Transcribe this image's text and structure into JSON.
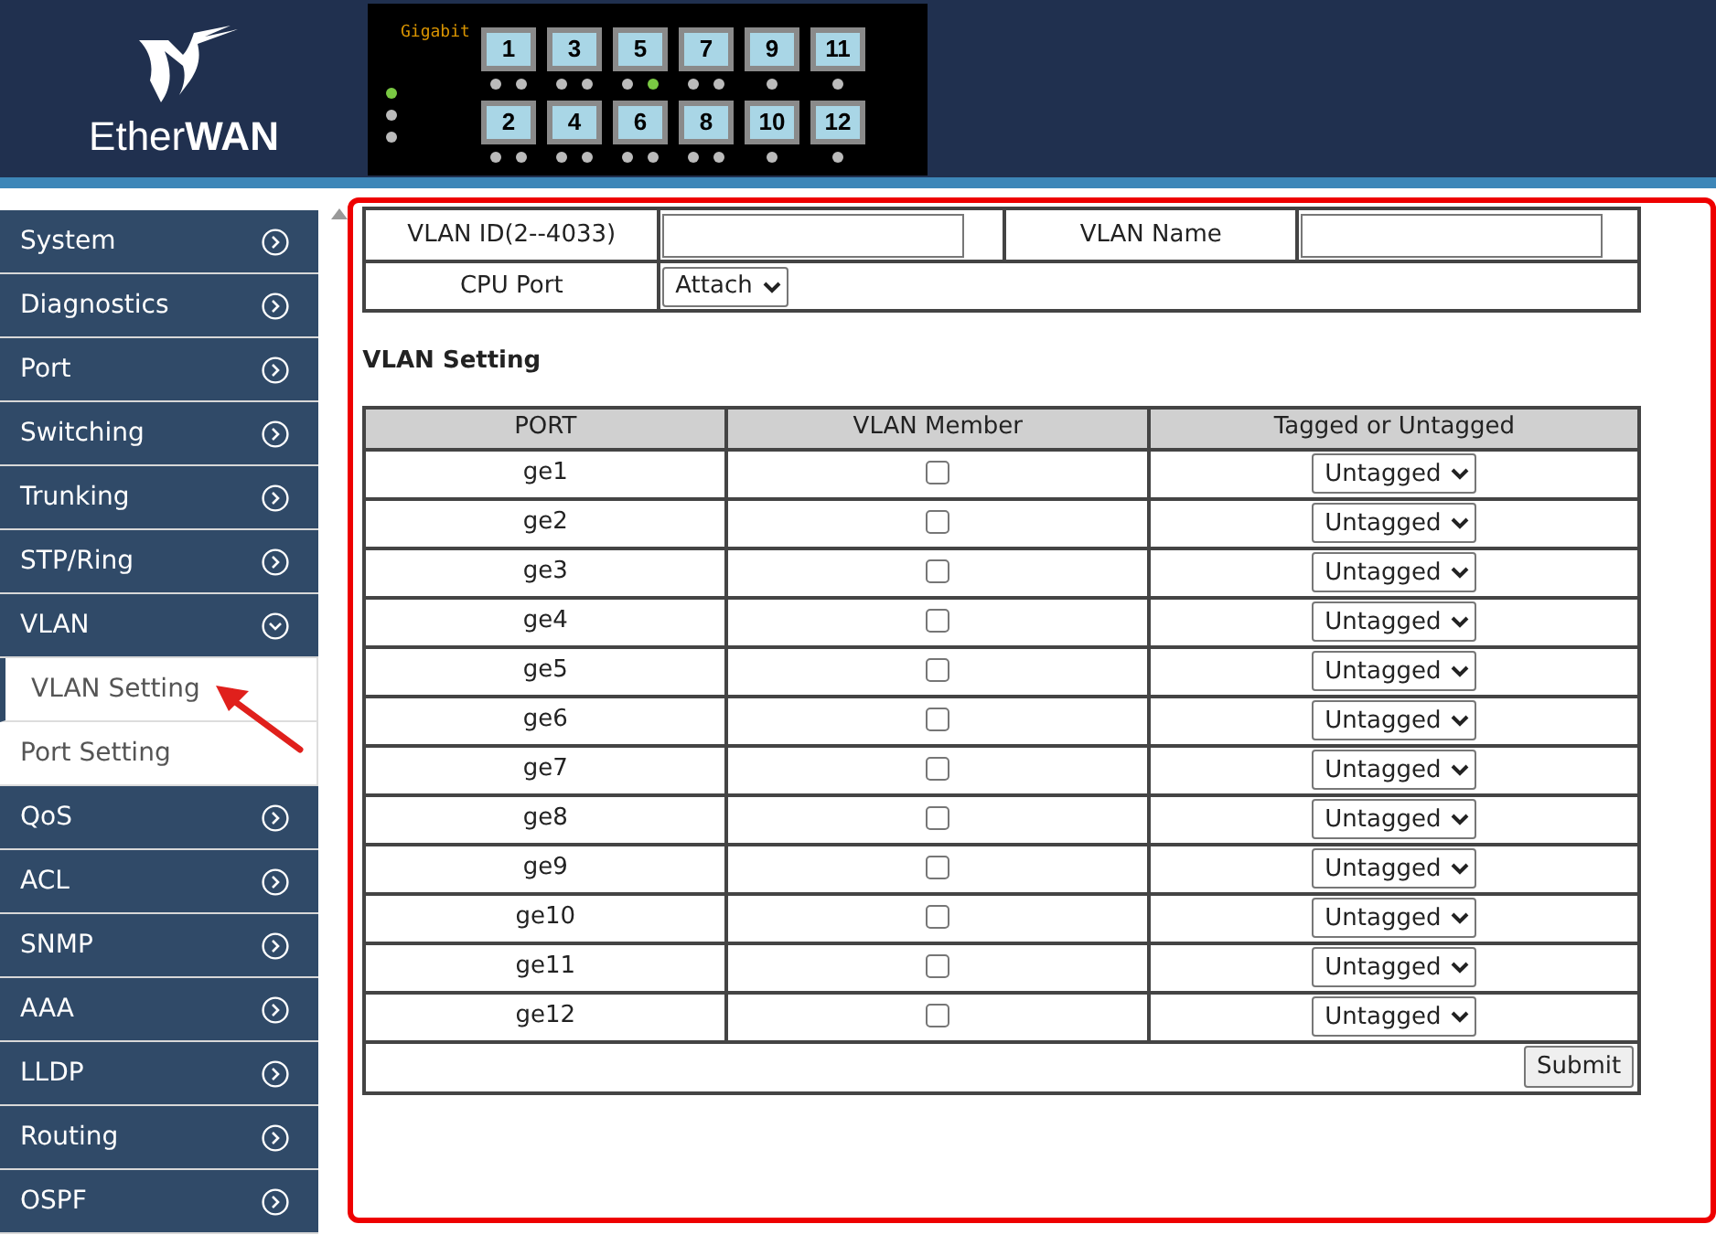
{
  "header": {
    "logo_text": "Ether**WAN**",
    "panel": {
      "speed_label": "Gigabit",
      "status_leds": [
        true,
        false,
        false
      ],
      "ports": [
        {
          "label": "1",
          "leds": [
            false,
            false
          ]
        },
        {
          "label": "3",
          "leds": [
            false,
            false
          ]
        },
        {
          "label": "5",
          "leds": [
            false,
            true
          ]
        },
        {
          "label": "7",
          "leds": [
            false,
            false
          ]
        },
        {
          "label": "9",
          "leds": [
            false
          ]
        },
        {
          "label": "11",
          "leds": [
            false
          ]
        },
        {
          "label": "2",
          "leds": [
            false,
            false
          ]
        },
        {
          "label": "4",
          "leds": [
            false,
            false
          ]
        },
        {
          "label": "6",
          "leds": [
            false,
            false
          ]
        },
        {
          "label": "8",
          "leds": [
            false,
            false
          ]
        },
        {
          "label": "10",
          "leds": [
            false
          ]
        },
        {
          "label": "12",
          "leds": [
            false
          ]
        }
      ]
    }
  },
  "sidebar": {
    "items": [
      {
        "label": "System",
        "expanded": false
      },
      {
        "label": "Diagnostics",
        "expanded": false
      },
      {
        "label": "Port",
        "expanded": false
      },
      {
        "label": "Switching",
        "expanded": false
      },
      {
        "label": "Trunking",
        "expanded": false
      },
      {
        "label": "STP/Ring",
        "expanded": false
      },
      {
        "label": "VLAN",
        "expanded": true,
        "children": [
          {
            "label": "VLAN Setting",
            "selected": true
          },
          {
            "label": "Port Setting",
            "selected": false
          }
        ]
      },
      {
        "label": "QoS",
        "expanded": false
      },
      {
        "label": "ACL",
        "expanded": false
      },
      {
        "label": "SNMP",
        "expanded": false
      },
      {
        "label": "AAA",
        "expanded": false
      },
      {
        "label": "LLDP",
        "expanded": false
      },
      {
        "label": "Routing",
        "expanded": false
      },
      {
        "label": "OSPF",
        "expanded": false
      }
    ]
  },
  "vlan_form": {
    "vlan_id_label": "VLAN ID(2--4033)",
    "vlan_name_label": "VLAN Name",
    "cpu_port_label": "CPU Port",
    "cpu_port_value": "Attach"
  },
  "section_title": "VLAN Setting",
  "table": {
    "columns": [
      "PORT",
      "VLAN Member",
      "Tagged or Untagged"
    ],
    "rows": [
      {
        "port": "ge1",
        "member": false,
        "tagging": "Untagged"
      },
      {
        "port": "ge2",
        "member": false,
        "tagging": "Untagged"
      },
      {
        "port": "ge3",
        "member": false,
        "tagging": "Untagged"
      },
      {
        "port": "ge4",
        "member": false,
        "tagging": "Untagged"
      },
      {
        "port": "ge5",
        "member": false,
        "tagging": "Untagged"
      },
      {
        "port": "ge6",
        "member": false,
        "tagging": "Untagged"
      },
      {
        "port": "ge7",
        "member": false,
        "tagging": "Untagged"
      },
      {
        "port": "ge8",
        "member": false,
        "tagging": "Untagged"
      },
      {
        "port": "ge9",
        "member": false,
        "tagging": "Untagged"
      },
      {
        "port": "ge10",
        "member": false,
        "tagging": "Untagged"
      },
      {
        "port": "ge11",
        "member": false,
        "tagging": "Untagged"
      },
      {
        "port": "ge12",
        "member": false,
        "tagging": "Untagged"
      }
    ]
  },
  "submit_button": "Submit"
}
